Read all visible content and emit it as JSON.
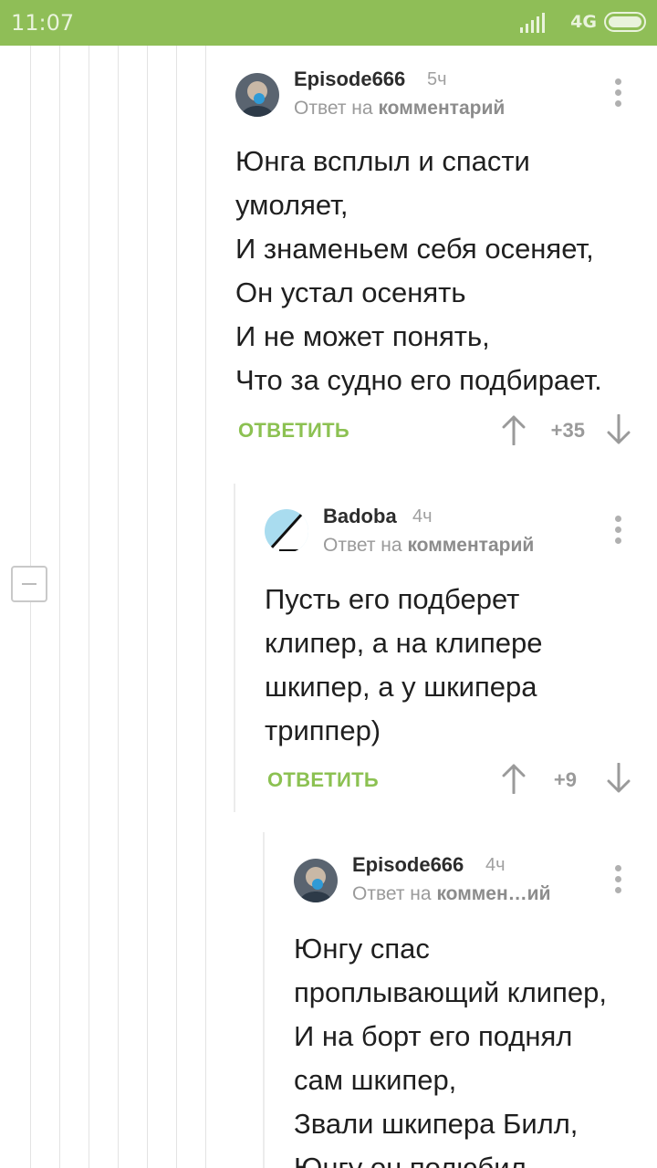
{
  "status_bar": {
    "time": "11:07",
    "network": "4G",
    "signal_icon": "signal-icon",
    "battery_icon": "battery-icon"
  },
  "comments": [
    {
      "author": "Episode666",
      "time": "5ч",
      "reply_prefix": "Ответ на",
      "reply_target": "комментарий",
      "text_lines": [
        "Юнга всплыл и спасти",
        "умоляет,",
        "И знаменьем себя осеняет,",
        "Он устал осенять",
        "И не может понять,",
        "Что за судно его подбирает."
      ],
      "reply_label": "ОТВЕТИТЬ",
      "score": "+35"
    },
    {
      "author": "Badoba",
      "time": "4ч",
      "reply_prefix": "Ответ на",
      "reply_target": "комментарий",
      "text_lines": [
        "Пусть его подберет",
        "клипер, а на клипере",
        "шкипер, а у шкипера",
        "триппер)"
      ],
      "reply_label": "ОТВЕТИТЬ",
      "score": "+9"
    },
    {
      "author": "Episode666",
      "time": "4ч",
      "reply_prefix": "Ответ на",
      "reply_target": "коммен…ий",
      "text_lines": [
        "Юнгу спас",
        "проплывающий клипер,",
        "И на борт его поднял",
        "сам шкипер,",
        "Звали шкипера Билл,",
        "Юнгу он полюбил"
      ]
    }
  ],
  "colors": {
    "status_bar": "#8fbe57",
    "accent_green": "#8cc152"
  }
}
